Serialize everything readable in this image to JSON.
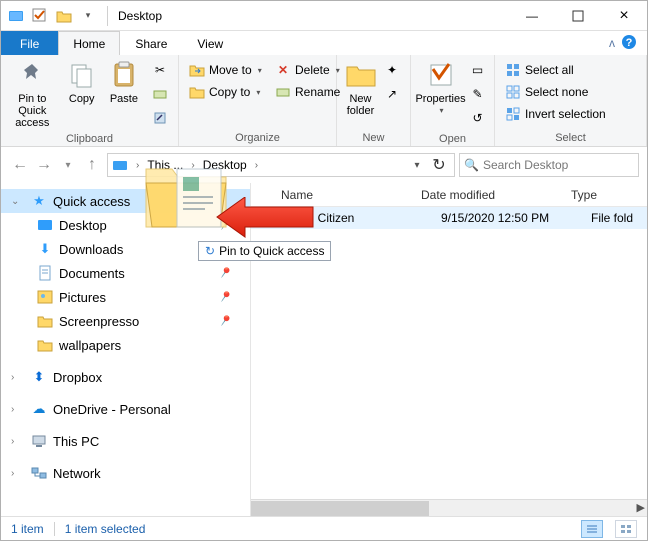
{
  "title": "Desktop",
  "tabs": {
    "file": "File",
    "home": "Home",
    "share": "Share",
    "view": "View"
  },
  "ribbon": {
    "clipboard": {
      "label": "Clipboard",
      "pin": "Pin to Quick access",
      "copy": "Copy",
      "paste": "Paste"
    },
    "organize": {
      "label": "Organize",
      "move": "Move to",
      "copy": "Copy to",
      "delete": "Delete",
      "rename": "Rename"
    },
    "new": {
      "label": "New",
      "newfolder": "New folder"
    },
    "open": {
      "label": "Open",
      "properties": "Properties"
    },
    "select": {
      "label": "Select",
      "all": "Select all",
      "none": "Select none",
      "invert": "Invert selection"
    }
  },
  "address": {
    "root": "This ...",
    "current": "Desktop"
  },
  "search": {
    "placeholder": "Search Desktop"
  },
  "tree": {
    "quick": "Quick access",
    "items": [
      {
        "label": "Desktop",
        "pinned": true
      },
      {
        "label": "Downloads",
        "pinned": true
      },
      {
        "label": "Documents",
        "pinned": true
      },
      {
        "label": "Pictures",
        "pinned": true
      },
      {
        "label": "Screenpresso",
        "pinned": true
      },
      {
        "label": "wallpapers",
        "pinned": false
      }
    ],
    "dropbox": "Dropbox",
    "onedrive": "OneDrive - Personal",
    "thispc": "This PC",
    "network": "Network"
  },
  "columns": {
    "name": "Name",
    "date": "Date modified",
    "type": "Type"
  },
  "rows": [
    {
      "name": "Digital Citizen",
      "date": "9/15/2020 12:50 PM",
      "type": "File fold"
    }
  ],
  "drag_tip": "Pin to Quick access",
  "status": {
    "count": "1 item",
    "selected": "1 item selected"
  }
}
